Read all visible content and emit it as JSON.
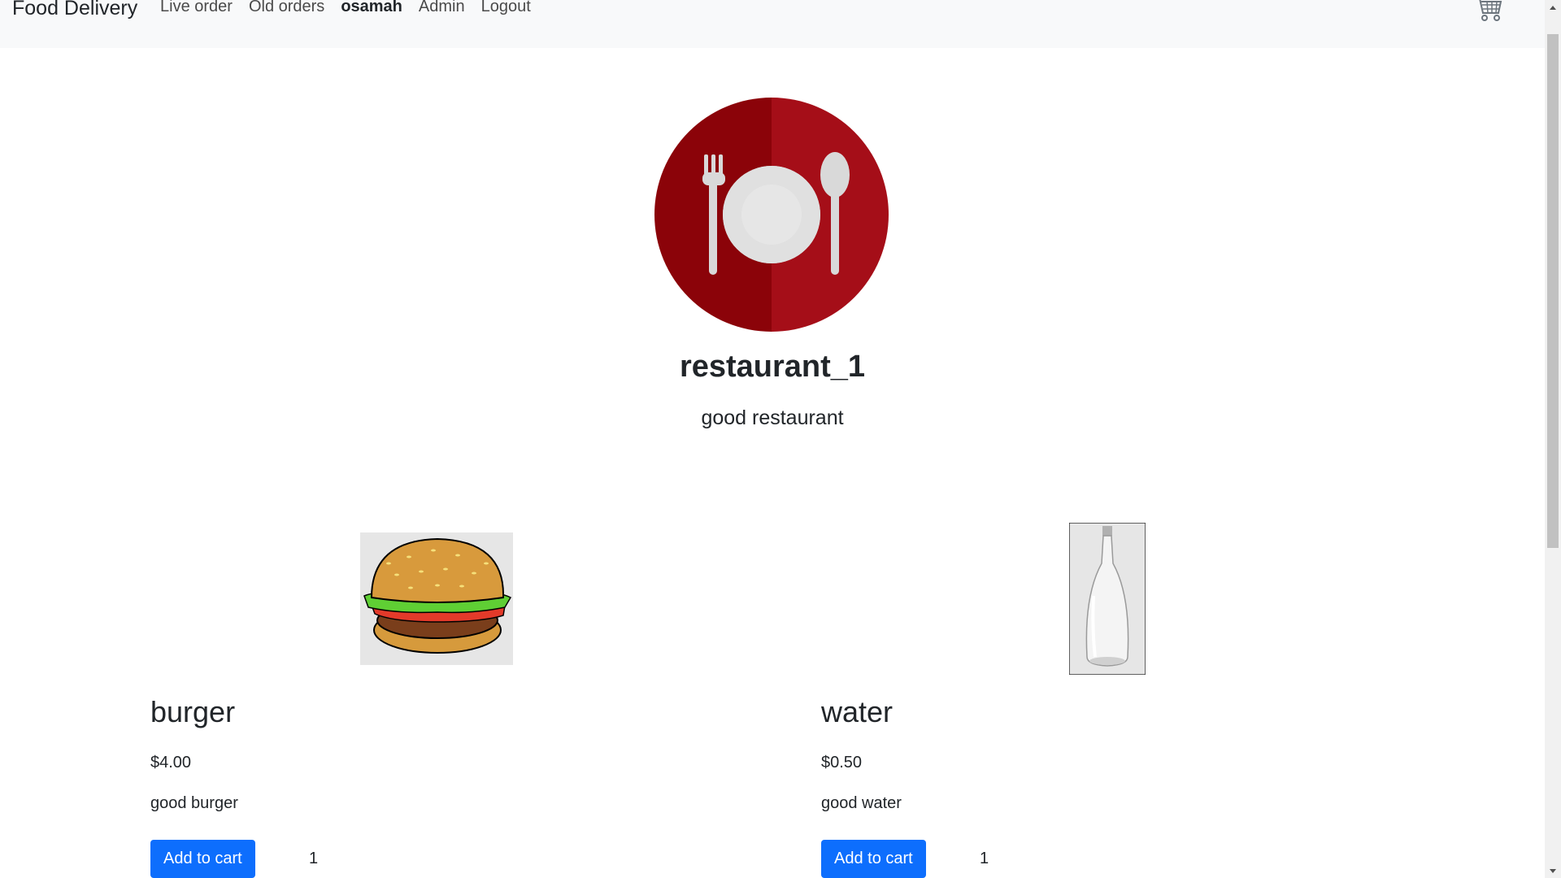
{
  "navbar": {
    "brand": "Food Delivery",
    "links": [
      {
        "label": "Live order"
      },
      {
        "label": "Old orders"
      },
      {
        "label": "osamah"
      },
      {
        "label": "Admin"
      },
      {
        "label": "Logout"
      }
    ],
    "cart_icon": "shopping-cart-icon"
  },
  "restaurant": {
    "logo_icon": "plate-fork-spoon-icon",
    "name": "restaurant_1",
    "description": "good restaurant"
  },
  "items": [
    {
      "name": "burger",
      "price": "$4.00",
      "description": "good burger",
      "button": "Add to cart",
      "quantity": "1",
      "image_icon": "burger-image"
    },
    {
      "name": "water",
      "price": "$0.50",
      "description": "good water",
      "button": "Add to cart",
      "quantity": "1",
      "image_icon": "water-bottle-image"
    }
  ],
  "colors": {
    "accent": "#0d6efd",
    "logo_red": "#a50e18",
    "logo_dark_red": "#8b0309"
  }
}
